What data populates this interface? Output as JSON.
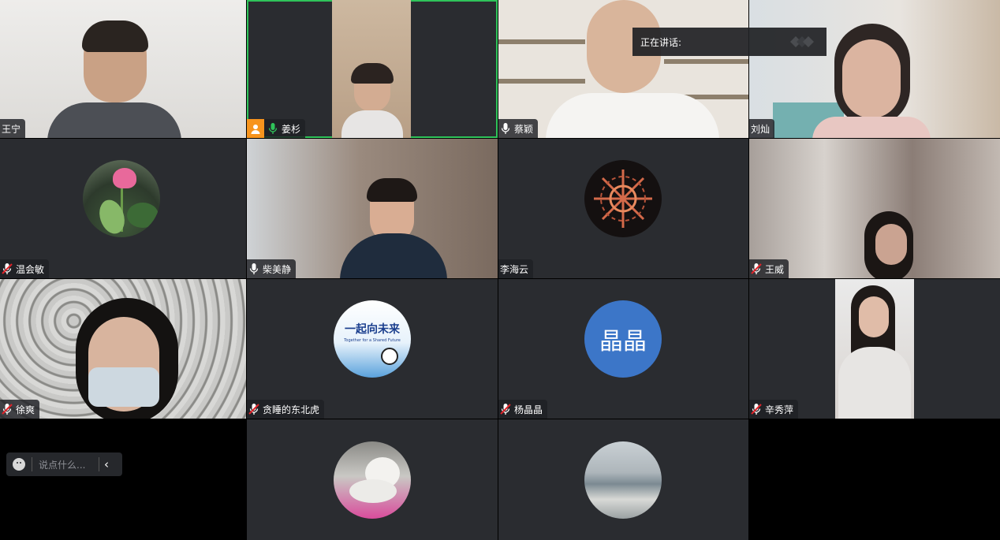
{
  "speaking_banner": {
    "label": "正在讲话:"
  },
  "participants": [
    {
      "name": "王宁"
    },
    {
      "name": "姜杉"
    },
    {
      "name": "蔡颖"
    },
    {
      "name": "刘灿"
    },
    {
      "name": "温会敏"
    },
    {
      "name": "柴美静"
    },
    {
      "name": "李海云"
    },
    {
      "name": "王威"
    },
    {
      "name": "徐爽"
    },
    {
      "name": "贪睡的东北虎"
    },
    {
      "name": "杨晶晶"
    },
    {
      "name": "辛秀萍"
    }
  ],
  "avatars": {
    "future_text_cn": "一起向未来",
    "future_text_en": "Together for a Shared Future",
    "initials": "晶晶",
    "initials_bg": "#3c76c8"
  },
  "chat": {
    "placeholder": "说点什么...",
    "collapse_icon": "chevron-left-icon"
  },
  "colors": {
    "active_border": "#2fc45a",
    "mic_on": "#2fc45a",
    "mic_muted": "#e0242a",
    "host_badge": "#f7941d"
  }
}
